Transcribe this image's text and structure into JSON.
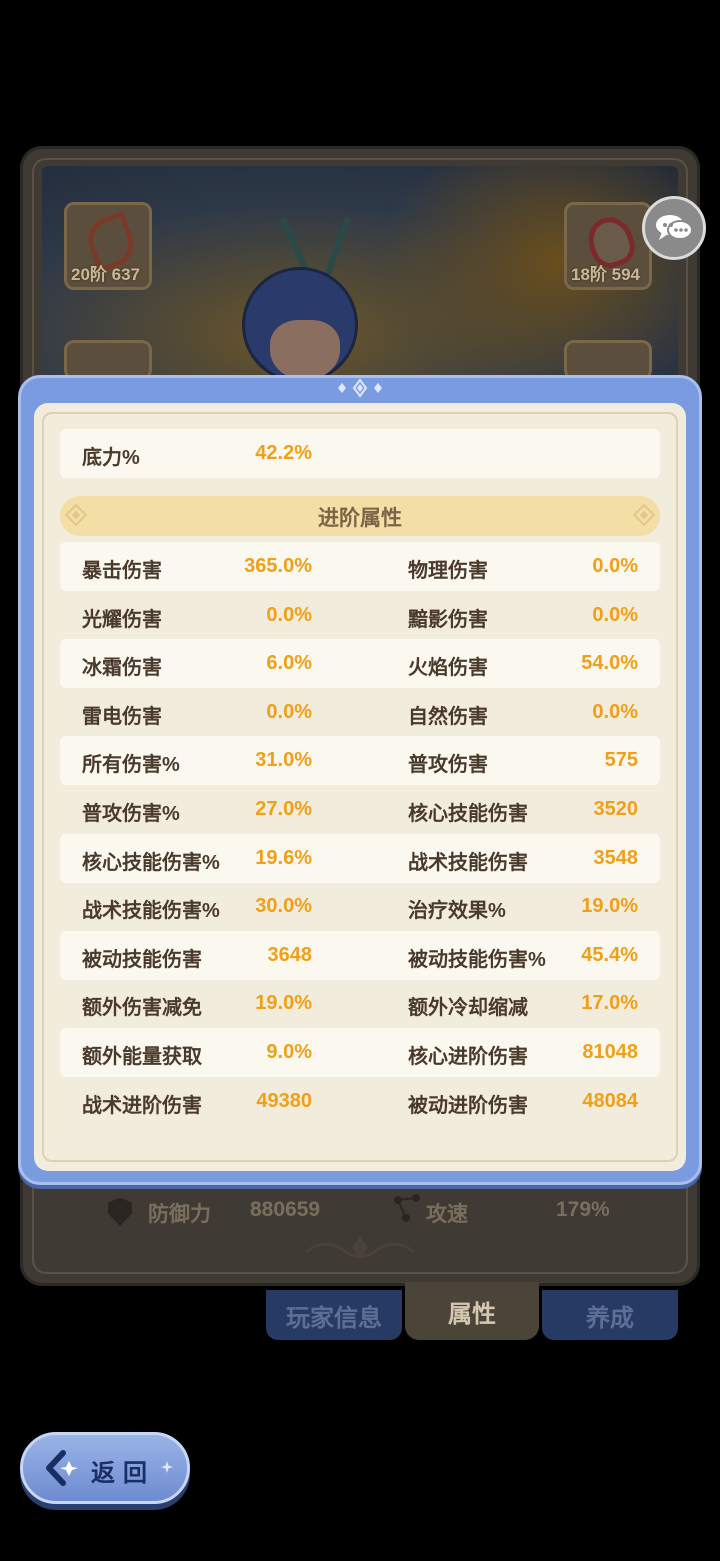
{
  "background": {
    "equip_left_top": "20阶 637",
    "equip_right_top": "18阶 594",
    "stats": {
      "defense_label": "防御力",
      "defense_value": "880659",
      "speed_label": "攻速",
      "speed_value": "179%"
    }
  },
  "tabs": [
    {
      "label": "玩家信息",
      "active": false
    },
    {
      "label": "属性",
      "active": true
    },
    {
      "label": "养成",
      "active": false
    }
  ],
  "back_button": {
    "label": "返回"
  },
  "panel": {
    "top_row": {
      "label": "底力%",
      "value": "42.2%"
    },
    "section_title": "进阶属性",
    "rows": [
      {
        "l_label": "暴击伤害",
        "l_value": "365.0%",
        "r_label": "物理伤害",
        "r_value": "0.0%"
      },
      {
        "l_label": "光耀伤害",
        "l_value": "0.0%",
        "r_label": "黯影伤害",
        "r_value": "0.0%"
      },
      {
        "l_label": "冰霜伤害",
        "l_value": "6.0%",
        "r_label": "火焰伤害",
        "r_value": "54.0%"
      },
      {
        "l_label": "雷电伤害",
        "l_value": "0.0%",
        "r_label": "自然伤害",
        "r_value": "0.0%"
      },
      {
        "l_label": "所有伤害%",
        "l_value": "31.0%",
        "r_label": "普攻伤害",
        "r_value": "575"
      },
      {
        "l_label": "普攻伤害%",
        "l_value": "27.0%",
        "r_label": "核心技能伤害",
        "r_value": "3520"
      },
      {
        "l_label": "核心技能伤害%",
        "l_value": "19.6%",
        "r_label": "战术技能伤害",
        "r_value": "3548"
      },
      {
        "l_label": "战术技能伤害%",
        "l_value": "30.0%",
        "r_label": "治疗效果%",
        "r_value": "19.0%"
      },
      {
        "l_label": "被动技能伤害",
        "l_value": "3648",
        "r_label": "被动技能伤害%",
        "r_value": "45.4%"
      },
      {
        "l_label": "额外伤害减免",
        "l_value": "19.0%",
        "r_label": "额外冷却缩减",
        "r_value": "17.0%"
      },
      {
        "l_label": "额外能量获取",
        "l_value": "9.0%",
        "r_label": "核心进阶伤害",
        "r_value": "81048"
      },
      {
        "l_label": "战术进阶伤害",
        "l_value": "49380",
        "r_label": "被动进阶伤害",
        "r_value": "48084"
      }
    ]
  },
  "colors": {
    "panel_blue": "#7a9be0",
    "panel_cream": "#f2ecdd",
    "value_orange": "#f0a018",
    "label_brown": "#4a3a2c",
    "section_bg": "#f3dea6"
  }
}
